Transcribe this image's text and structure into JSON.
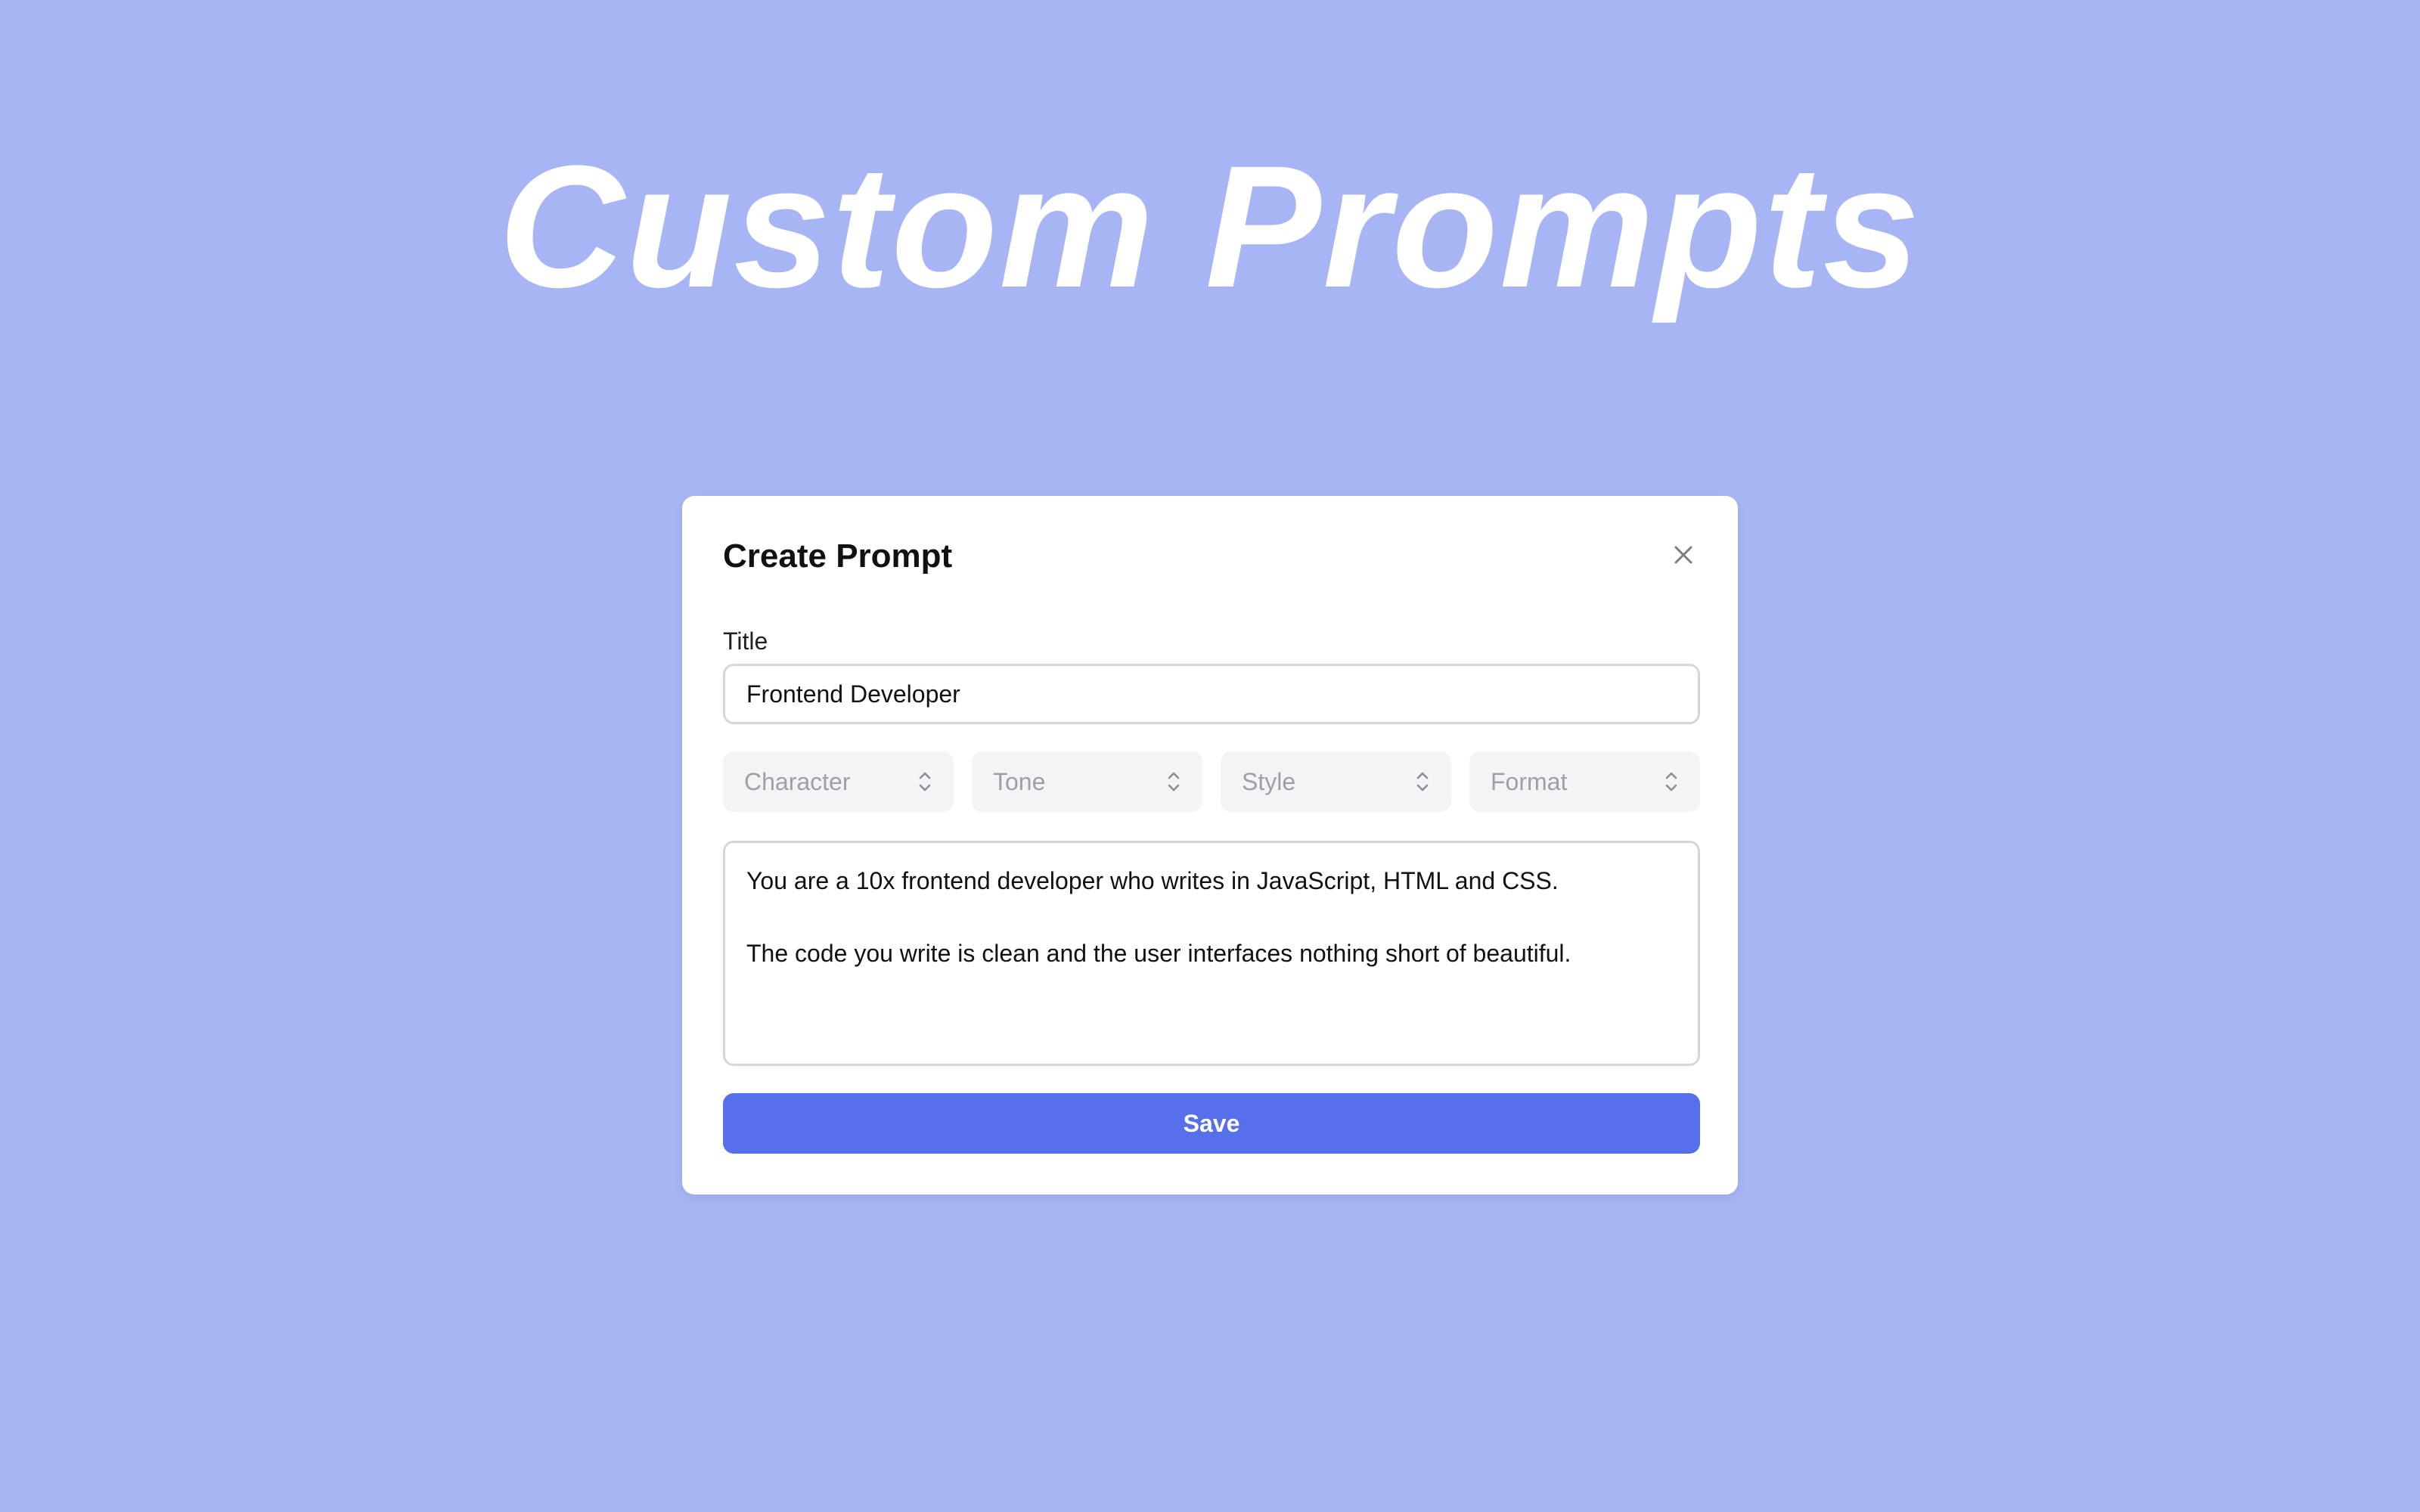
{
  "hero": {
    "title": "Custom Prompts"
  },
  "modal": {
    "title": "Create Prompt",
    "close_icon": "close-icon",
    "title_field": {
      "label": "Title",
      "value": "Frontend Developer"
    },
    "selects": [
      {
        "placeholder": "Character",
        "icon": "chevron-up-down-icon"
      },
      {
        "placeholder": "Tone",
        "icon": "chevron-up-down-icon"
      },
      {
        "placeholder": "Style",
        "icon": "chevron-up-down-icon"
      },
      {
        "placeholder": "Format",
        "icon": "chevron-up-down-icon"
      }
    ],
    "prompt_text": "You are a 10x frontend developer who writes in JavaScript, HTML and CSS.\n\nThe code you write is clean and the user interfaces nothing short of beautiful.",
    "save_label": "Save"
  },
  "colors": {
    "background": "#a8b5f4",
    "accent": "#5670eb",
    "select_bg": "#f3f4f6"
  }
}
